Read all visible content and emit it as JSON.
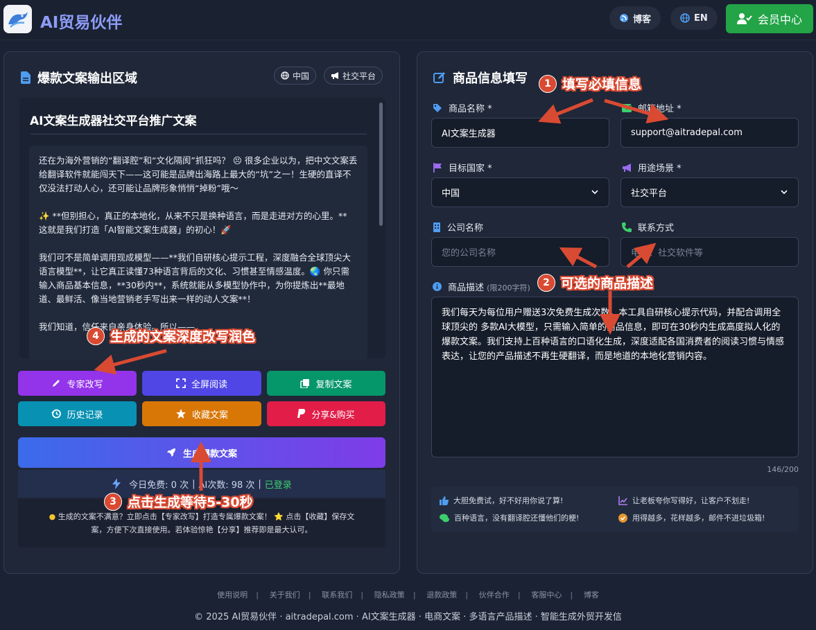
{
  "header": {
    "brand": "AI贸易伙伴",
    "blog_label": "博客",
    "lang_label": "EN",
    "member_label": "会员中心"
  },
  "left_panel": {
    "title": "爆款文案输出区域",
    "tags": [
      "中国",
      "社交平台"
    ],
    "doc_title": "AI文案生成器社交平台推广文案",
    "paragraphs": [
      "还在为海外营销的“翻译腔”和“文化隔阂”抓狂吗？ 😣 很多企业以为，把中文文案丢给翻译软件就能闯天下——这可能是品牌出海路上最大的“坑”之一！生硬的直译不仅没法打动人心，还可能让品牌形象悄悄“掉粉”哦～",
      "✨ **但别担心，真正的本地化，从来不只是换种语言，而是走进对方的心里。**\n这就是我们打造「AI智能文案生成器」的初心！🚀",
      "我们可不是简单调用现成模型——**我们自研核心提示工程，深度融合全球顶尖大语言模型**，让它真正读懂73种语言背后的文化、习惯甚至情感温度。🌏 你只需输入商品基本信息，**30秒内**，系统就能从多模型协作中，为你提炼出**最地道、最鲜活、像当地营销老手写出来一样的动人文案**！",
      "我们知道，信任来自亲身体验。所以——"
    ],
    "buttons": [
      {
        "label": "专家改写",
        "color": "#9333ea"
      },
      {
        "label": "全屏阅读",
        "color": "#4f46e5"
      },
      {
        "label": "复制文案",
        "color": "#059669"
      },
      {
        "label": "历史记录",
        "color": "#0891b2"
      },
      {
        "label": "收藏文案",
        "color": "#d97706"
      },
      {
        "label": "分享&购买",
        "color": "#e11d48"
      }
    ],
    "generate_label": "生成爆款文案",
    "quota_free": "今日免费: 0 次",
    "quota_ai": "AI次数: 98 次",
    "quota_status": "已登录",
    "tip_line1": "生成的文案不满意？立即点击【专家改写】打造专属爆款文案！ ⭐ 点击【收藏】保存文",
    "tip_line2": "案，方便下次直接使用。若体验惊艳【分享】推荐即是最大认可。"
  },
  "right_panel": {
    "title": "商品信息填写",
    "fields": {
      "product_name": {
        "label": "商品名称 *",
        "value": "AI文案生成器"
      },
      "email": {
        "label": "邮箱地址 *",
        "value": "support@aitradepal.com"
      },
      "country": {
        "label": "目标国家 *",
        "value": "中国"
      },
      "scene": {
        "label": "用途场景 *",
        "value": "社交平台"
      },
      "company": {
        "label": "公司名称",
        "placeholder": "您的公司名称"
      },
      "contact": {
        "label": "联系方式",
        "placeholder": "电话、社交软件等"
      },
      "description": {
        "label": "商品描述",
        "hint": "(限200字符)",
        "value": "我们每天为每位用户赠送3次免费生成次数。本工具自研核心提示代码，并配合调用全球顶尖的 多款AI大模型，只需输入简单的商品信息，即可在30秒内生成高度拟人化的爆款文案。我们支持上百种语言的口语化生成，深度适配各国消费者的阅读习惯与情感表达，让您的产品描述不再生硬翻译，而是地道的本地化营销内容。"
      }
    },
    "char_count": "146/200",
    "features": [
      "大胆免费试，好不好用你说了算!",
      "让老板夸你写得好，让客户不划走!",
      "百种语言，没有翻译腔还懂他们的梗!",
      "用得越多，花样越多，邮件不进垃圾箱!"
    ]
  },
  "annotations": [
    {
      "num": "1",
      "text": "填写必填信息"
    },
    {
      "num": "2",
      "text": "可选的商品描述"
    },
    {
      "num": "3",
      "text": "点击生成等待5-30秒"
    },
    {
      "num": "4",
      "text": "生成的文案深度改写润色"
    }
  ],
  "footer": {
    "links": [
      "使用说明",
      "关于我们",
      "联系我们",
      "隐私政策",
      "退款政策",
      "伙伴合作",
      "客服中心",
      "博客"
    ],
    "copyright": "© 2025 AI贸易伙伴 · aitradepal.com · AI文案生成器 · 电商文案 · 多语言产品描述 · 智能生成外贸开发信"
  },
  "colors": {
    "accent": "#8d9cf7",
    "member_green": "#22a447",
    "annotation_red": "#d94a32"
  }
}
